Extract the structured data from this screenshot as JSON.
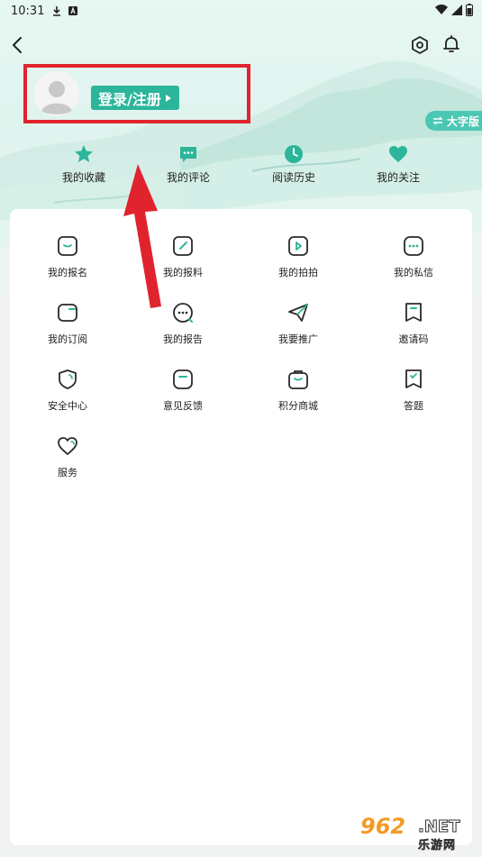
{
  "status_bar": {
    "time": "10:31"
  },
  "profile": {
    "login_label": "登录/注册"
  },
  "big_font_toggle": {
    "label": "大字版"
  },
  "quick_links": [
    {
      "label": "我的收藏",
      "icon": "star-icon"
    },
    {
      "label": "我的评论",
      "icon": "comment-icon"
    },
    {
      "label": "阅读历史",
      "icon": "clock-icon"
    },
    {
      "label": "我的关注",
      "icon": "heart-icon"
    }
  ],
  "menu_grid": [
    {
      "label": "我的报名",
      "icon": "signup-icon"
    },
    {
      "label": "我的报料",
      "icon": "report-news-icon"
    },
    {
      "label": "我的拍拍",
      "icon": "video-icon"
    },
    {
      "label": "我的私信",
      "icon": "message-icon"
    },
    {
      "label": "我的订阅",
      "icon": "subscribe-icon"
    },
    {
      "label": "我的报告",
      "icon": "report-icon"
    },
    {
      "label": "我要推广",
      "icon": "send-icon"
    },
    {
      "label": "邀请码",
      "icon": "invite-code-icon"
    },
    {
      "label": "安全中心",
      "icon": "shield-icon"
    },
    {
      "label": "意见反馈",
      "icon": "feedback-icon"
    },
    {
      "label": "积分商城",
      "icon": "mall-icon"
    },
    {
      "label": "答题",
      "icon": "quiz-icon"
    },
    {
      "label": "服务",
      "icon": "service-heart-icon"
    }
  ],
  "watermark": {
    "number": "962",
    "domain": ".NET",
    "cn": "乐游网"
  },
  "colors": {
    "accent": "#2cb59a",
    "highlight_box": "#e0242e",
    "arrow": "#e0242e"
  }
}
